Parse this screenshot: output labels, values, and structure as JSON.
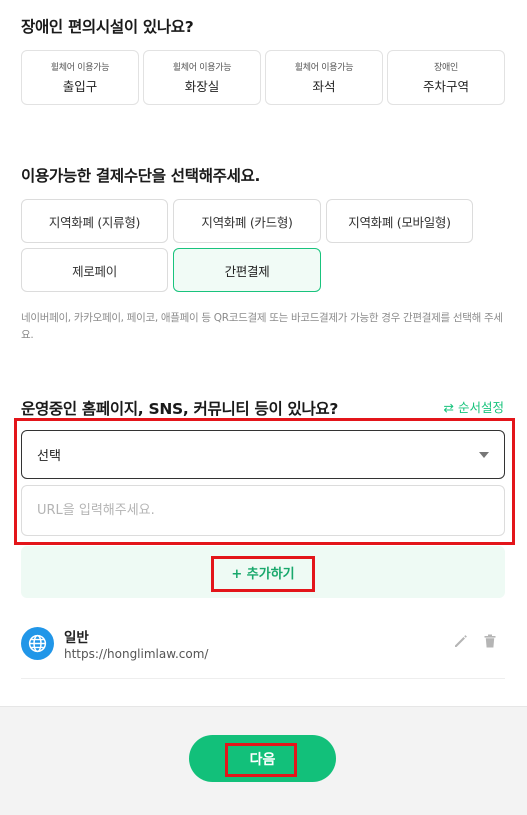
{
  "facilities": {
    "title": "장애인 편의시설이 있나요?",
    "items": [
      {
        "sub": "휠체어 이용가능",
        "label": "출입구"
      },
      {
        "sub": "휠체어 이용가능",
        "label": "화장실"
      },
      {
        "sub": "휠체어 이용가능",
        "label": "좌석"
      },
      {
        "sub": "장애인",
        "label": "주차구역"
      }
    ]
  },
  "payment": {
    "title": "이용가능한 결제수단을 선택해주세요.",
    "options": [
      {
        "label": "지역화폐 (지류형)",
        "selected": false
      },
      {
        "label": "지역화폐 (카드형)",
        "selected": false
      },
      {
        "label": "지역화폐 (모바일형)",
        "selected": false
      },
      {
        "label": "제로페이",
        "selected": false
      },
      {
        "label": "간편결제",
        "selected": true
      }
    ],
    "helper": "네이버페이, 카카오페이, 페이코, 애플페이 등 QR코드결제 또는 바코드결제가 가능한 경우 간편결제를 선택해 주세요."
  },
  "links": {
    "title": "운영중인 홈페이지, SNS, 커뮤니티 등이 있나요?",
    "order_label": "⇄ 순서설정",
    "select_value": "선택",
    "url_placeholder": "URL을 입력해주세요.",
    "add_label": "+ 추가하기",
    "items": [
      {
        "name": "일반",
        "url": "https://honglimlaw.com/"
      }
    ]
  },
  "footer": {
    "next_label": "다음"
  },
  "colors": {
    "accent": "#19c37d",
    "highlight": "#e3151a",
    "globe": "#2196e8"
  }
}
